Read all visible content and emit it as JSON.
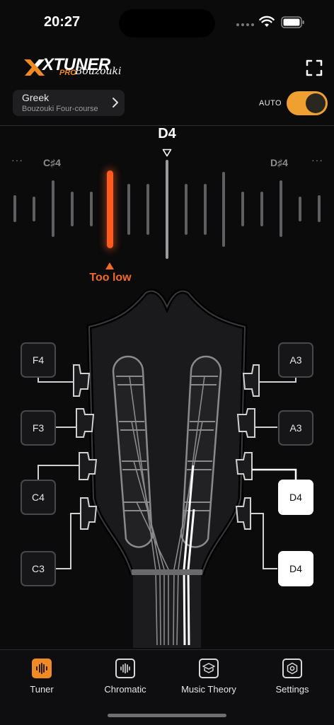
{
  "status": {
    "time": "20:27"
  },
  "header": {
    "logo_main": "XTUNER",
    "logo_pro": "PRO",
    "logo_script": "Bouzouki",
    "preset_title": "Greek",
    "preset_subtitle": "Bouzouki Four-course",
    "auto_label": "AUTO",
    "auto_on": true
  },
  "tuner": {
    "target_note": "D4",
    "prev_note": "C♯4",
    "next_note": "D♯4",
    "more_glyph": "···",
    "status_text": "Too low",
    "accent_color": "#ff5a1f"
  },
  "pegs": {
    "left": [
      "F4",
      "F3",
      "C4",
      "C3"
    ],
    "right": [
      "A3",
      "A3",
      "D4",
      "D4"
    ],
    "active_right": [
      false,
      false,
      true,
      true
    ]
  },
  "tabs": [
    {
      "label": "Tuner",
      "icon": "tuner-icon",
      "active": true
    },
    {
      "label": "Chromatic",
      "icon": "chromatic-icon",
      "active": false
    },
    {
      "label": "Music Theory",
      "icon": "music-theory-icon",
      "active": false
    },
    {
      "label": "Settings",
      "icon": "settings-icon",
      "active": false
    }
  ]
}
